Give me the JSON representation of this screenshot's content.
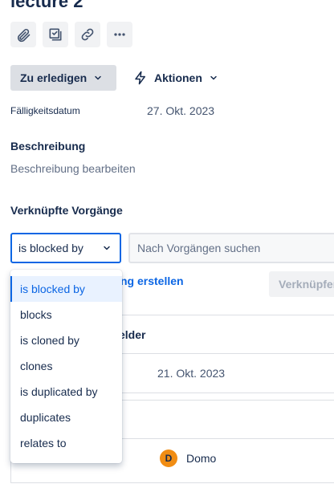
{
  "issue": {
    "title": "lecture 2"
  },
  "toolbar": {
    "icons": [
      "attachment-icon",
      "subtask-icon",
      "link-icon",
      "more-icon"
    ]
  },
  "status": {
    "label": "Zu erledigen"
  },
  "actions": {
    "label": "Aktionen"
  },
  "due_date": {
    "label": "Fälligkeitsdatum",
    "value": "27. Okt. 2023"
  },
  "description": {
    "title": "Beschreibung",
    "placeholder": "Beschreibung bearbeiten"
  },
  "linked_issues": {
    "title": "Verknüpfte Vorgänge",
    "relation_selected": "is blocked by",
    "search_placeholder": "Nach Vorgängen suchen",
    "create_link_text": "ng erstellen",
    "link_button_label": "Verknüpfen",
    "relation_options": [
      "is blocked by",
      "blocks",
      "is cloned by",
      "clones",
      "is duplicated by",
      "duplicates",
      "relates to"
    ]
  },
  "details": {
    "fields_title_partial": "elder",
    "date_value": "21. Okt. 2023",
    "assignee": {
      "initial": "D",
      "name": "Domo"
    }
  },
  "colors": {
    "accent": "#0c66e4",
    "status_bg": "#dcdfe4",
    "avatar_bg": "#f18d13"
  }
}
